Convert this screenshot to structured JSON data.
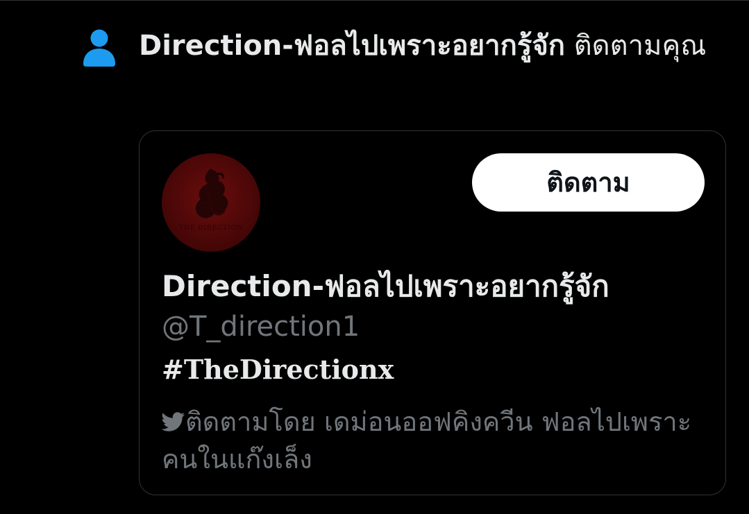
{
  "notification": {
    "name": "Direction-ฟอลไปเพราะอยากรู้จัก",
    "action": " ติดตามคุณ",
    "icon": "person-icon",
    "icon_color": "#1d9bf0"
  },
  "card": {
    "avatar_icon": "the-direction-logo",
    "avatar_label": "THE DIRECTION",
    "follow_label": "ติดตาม",
    "display_name": "Direction-ฟอลไปเพราะอยากรู้จัก",
    "handle": "@T_direction1",
    "bio": "#TheDirectionx",
    "followed_by_icon": "twitter-bird-icon",
    "followed_by": "ติดตามโดย เดม่อนออฟคิงควีน ฟอลไปเพราะคนในแก๊งเล็ง"
  },
  "colors": {
    "background": "#000000",
    "text_primary": "#e7e9ea",
    "text_secondary": "#71767b",
    "border": "#2f3336",
    "button_bg": "#ffffff",
    "button_text": "#0f1419"
  }
}
